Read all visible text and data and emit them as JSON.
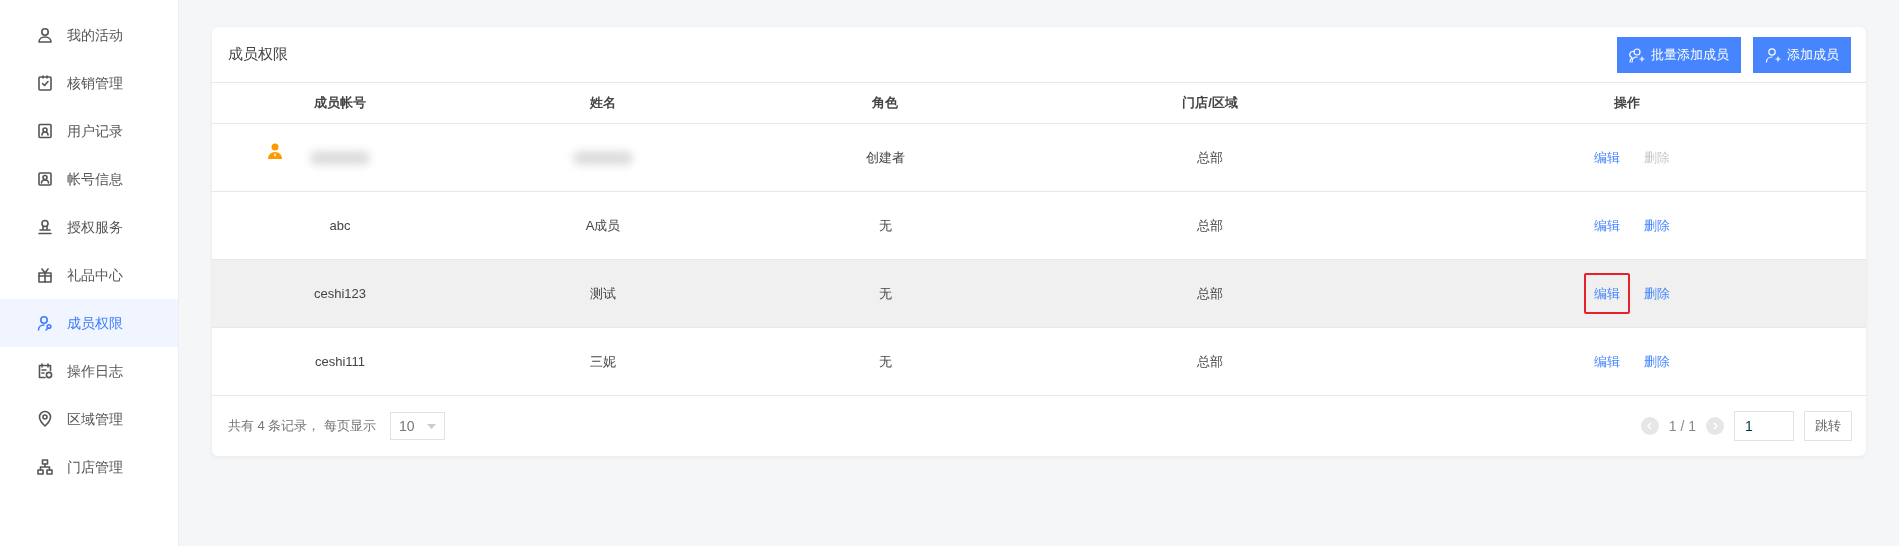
{
  "sidebar": {
    "items": [
      {
        "label": "我的活动",
        "selected": false
      },
      {
        "label": "核销管理",
        "selected": false
      },
      {
        "label": "用户记录",
        "selected": false
      },
      {
        "label": "帐号信息",
        "selected": false
      },
      {
        "label": "授权服务",
        "selected": false
      },
      {
        "label": "礼品中心",
        "selected": false
      },
      {
        "label": "成员权限",
        "selected": true
      },
      {
        "label": "操作日志",
        "selected": false
      },
      {
        "label": "区域管理",
        "selected": false
      },
      {
        "label": "门店管理",
        "selected": false
      }
    ]
  },
  "card": {
    "title": "成员权限",
    "buttons": [
      {
        "label": "批量添加成员"
      },
      {
        "label": "添加成员"
      }
    ]
  },
  "table": {
    "columns": [
      "成员帐号",
      "姓名",
      "角色",
      "门店/区域",
      "操作"
    ],
    "rows": [
      {
        "owner": true,
        "blurred": true,
        "role": "创建者",
        "store": "总部",
        "hovered": false,
        "edit": "编辑",
        "edit_highlighted": false,
        "delete": "删除",
        "delete_disabled": true
      },
      {
        "owner": false,
        "blurred": false,
        "account": "abc",
        "name": "A成员",
        "role": "无",
        "store": "总部",
        "hovered": false,
        "edit": "编辑",
        "edit_highlighted": false,
        "delete": "删除",
        "delete_disabled": false
      },
      {
        "owner": false,
        "blurred": false,
        "account": "ceshi123",
        "name": "测试",
        "role": "无",
        "store": "总部",
        "hovered": true,
        "edit": "编辑",
        "edit_highlighted": true,
        "delete": "删除",
        "delete_disabled": false
      },
      {
        "owner": false,
        "blurred": false,
        "account": "ceshi111",
        "name": "三妮",
        "role": "无",
        "store": "总部",
        "hovered": false,
        "edit": "编辑",
        "edit_highlighted": false,
        "delete": "删除",
        "delete_disabled": false
      }
    ]
  },
  "footer": {
    "summary": "共有 4 条记录， 每页显示",
    "page_size": "10",
    "page_info": "1 / 1",
    "page_input": "1",
    "jump": "跳转"
  }
}
